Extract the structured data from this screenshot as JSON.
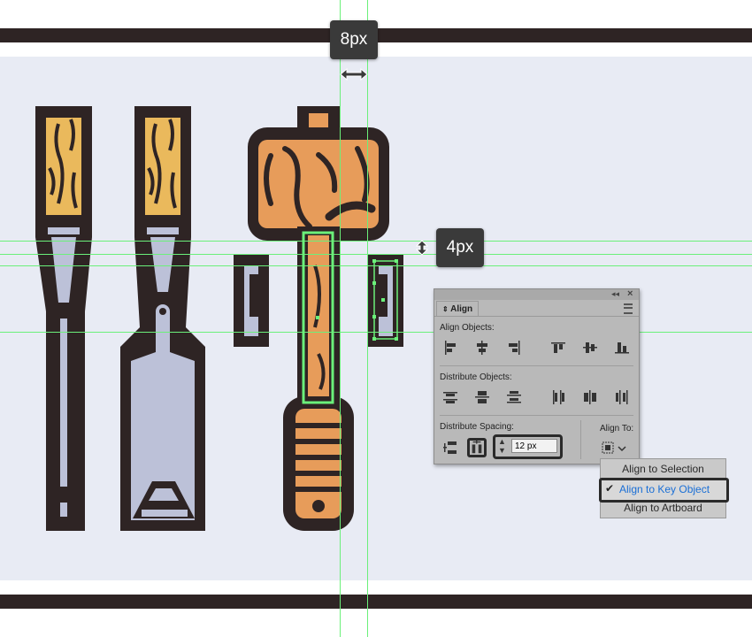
{
  "measurements": {
    "horizontal_gap": "8px",
    "vertical_gap": "4px"
  },
  "align_panel": {
    "tab_label": "Align",
    "collapse_icon": "double-chevron-icon",
    "close_icon": "close-icon",
    "menu_icon": "panel-menu-icon",
    "align_objects_label": "Align Objects:",
    "distribute_objects_label": "Distribute Objects:",
    "distribute_spacing_label": "Distribute Spacing:",
    "align_to_label": "Align To:",
    "spacing_value": "12 px"
  },
  "align_to_menu": {
    "items": [
      "Align to Selection",
      "Align to Key Object",
      "Align to Artboard"
    ],
    "selected": "Align to Key Object",
    "check_mark": "✔"
  },
  "colors": {
    "outline": "#2e2424",
    "wood_light": "#eab95c",
    "wood_orange": "#e79c5a",
    "blade": "#bcc1d8",
    "guide": "#6bf07a",
    "selection_text": "#1a6fd6"
  }
}
